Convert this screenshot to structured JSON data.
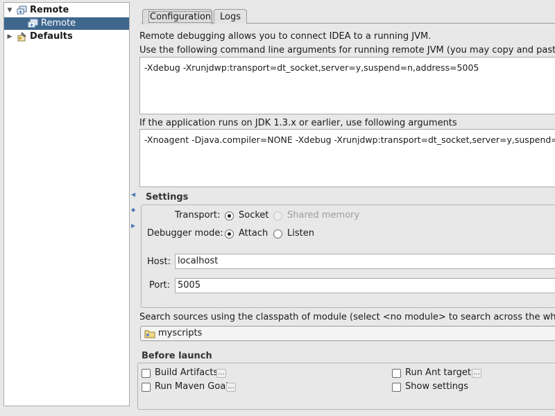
{
  "tree": {
    "items": [
      {
        "label": "Remote",
        "expanded": true,
        "bold": true,
        "icon": "remote-config-icon"
      },
      {
        "label": "Remote",
        "selected": true,
        "icon": "remote-run-icon"
      },
      {
        "label": "Defaults",
        "expanded": false,
        "bold": true,
        "icon": "defaults-wrench-icon"
      }
    ]
  },
  "tabs": [
    {
      "label": "Configuration",
      "active": true
    },
    {
      "label": "Logs",
      "active": false
    }
  ],
  "intro": {
    "line1": "Remote debugging allows you to connect IDEA to a running JVM.",
    "line2": "Use the following command line arguments for running remote JVM (you may copy and paste the"
  },
  "cmd1": "-Xdebug -Xrunjdwp:transport=dt_socket,server=y,suspend=n,address=5005",
  "jdk_note": "If the application runs on JDK 1.3.x or earlier, use following arguments",
  "cmd2": "-Xnoagent -Djava.compiler=NONE -Xdebug -Xrunjdwp:transport=dt_socket,server=y,suspend=n",
  "settings": {
    "title": "Settings",
    "transport_label": "Transport:",
    "transport_options": [
      {
        "label": "Socket",
        "checked": true,
        "enabled": true
      },
      {
        "label": "Shared memory",
        "checked": false,
        "enabled": false
      }
    ],
    "mode_label": "Debugger mode:",
    "mode_options": [
      {
        "label": "Attach",
        "checked": true
      },
      {
        "label": "Listen",
        "checked": false
      }
    ],
    "host_label": "Host:",
    "host_value": "localhost",
    "port_label": "Port:",
    "port_value": "5005"
  },
  "module": {
    "label": "Search sources using the classpath of module (select <no module> to search across the whole",
    "selected": "myscripts",
    "icon": "module-folder-icon"
  },
  "before_launch": {
    "title": "Before launch",
    "build_artifacts": "Build Artifacts",
    "run_maven_goal": "Run Maven Goal",
    "run_ant_target": "Run Ant target",
    "show_settings": "Show settings",
    "more_label": "..."
  }
}
